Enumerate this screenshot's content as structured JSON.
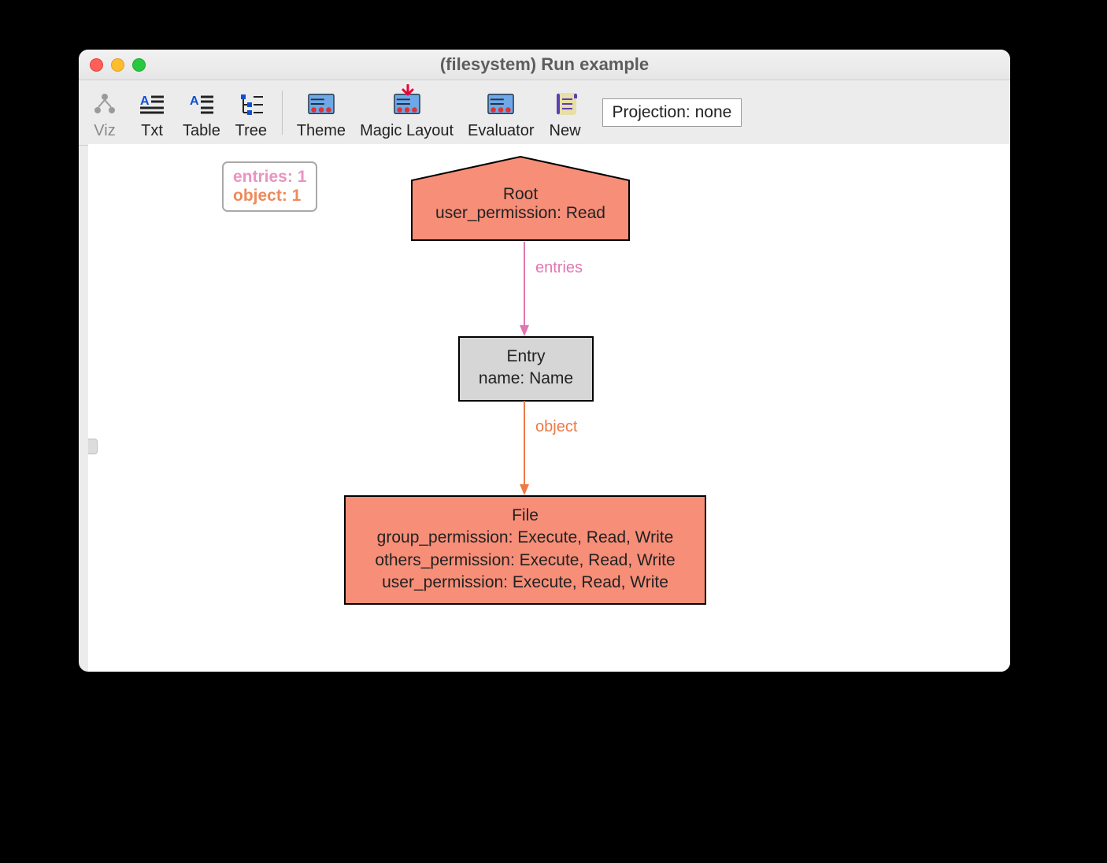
{
  "window": {
    "title": "(filesystem) Run example"
  },
  "toolbar": {
    "viz": "Viz",
    "txt": "Txt",
    "table": "Table",
    "tree": "Tree",
    "theme": "Theme",
    "magic_layout": "Magic Layout",
    "evaluator": "Evaluator",
    "new": "New",
    "projection": "Projection: none"
  },
  "legend": {
    "line1": "entries: 1",
    "line2": "object: 1"
  },
  "nodes": {
    "root": {
      "title": "Root",
      "line1": "user_permission: Read"
    },
    "entry": {
      "title": "Entry",
      "line1": "name: Name"
    },
    "file": {
      "title": "File",
      "line1": "group_permission: Execute, Read, Write",
      "line2": "others_permission: Execute, Read, Write",
      "line3": "user_permission: Execute, Read, Write"
    }
  },
  "edges": {
    "e1": "entries",
    "e2": "object"
  },
  "colors": {
    "node_fill": "#f78e78",
    "entry_fill": "#d6d6d6",
    "entries_edge": "#e176b1",
    "object_edge": "#ed7a45"
  }
}
